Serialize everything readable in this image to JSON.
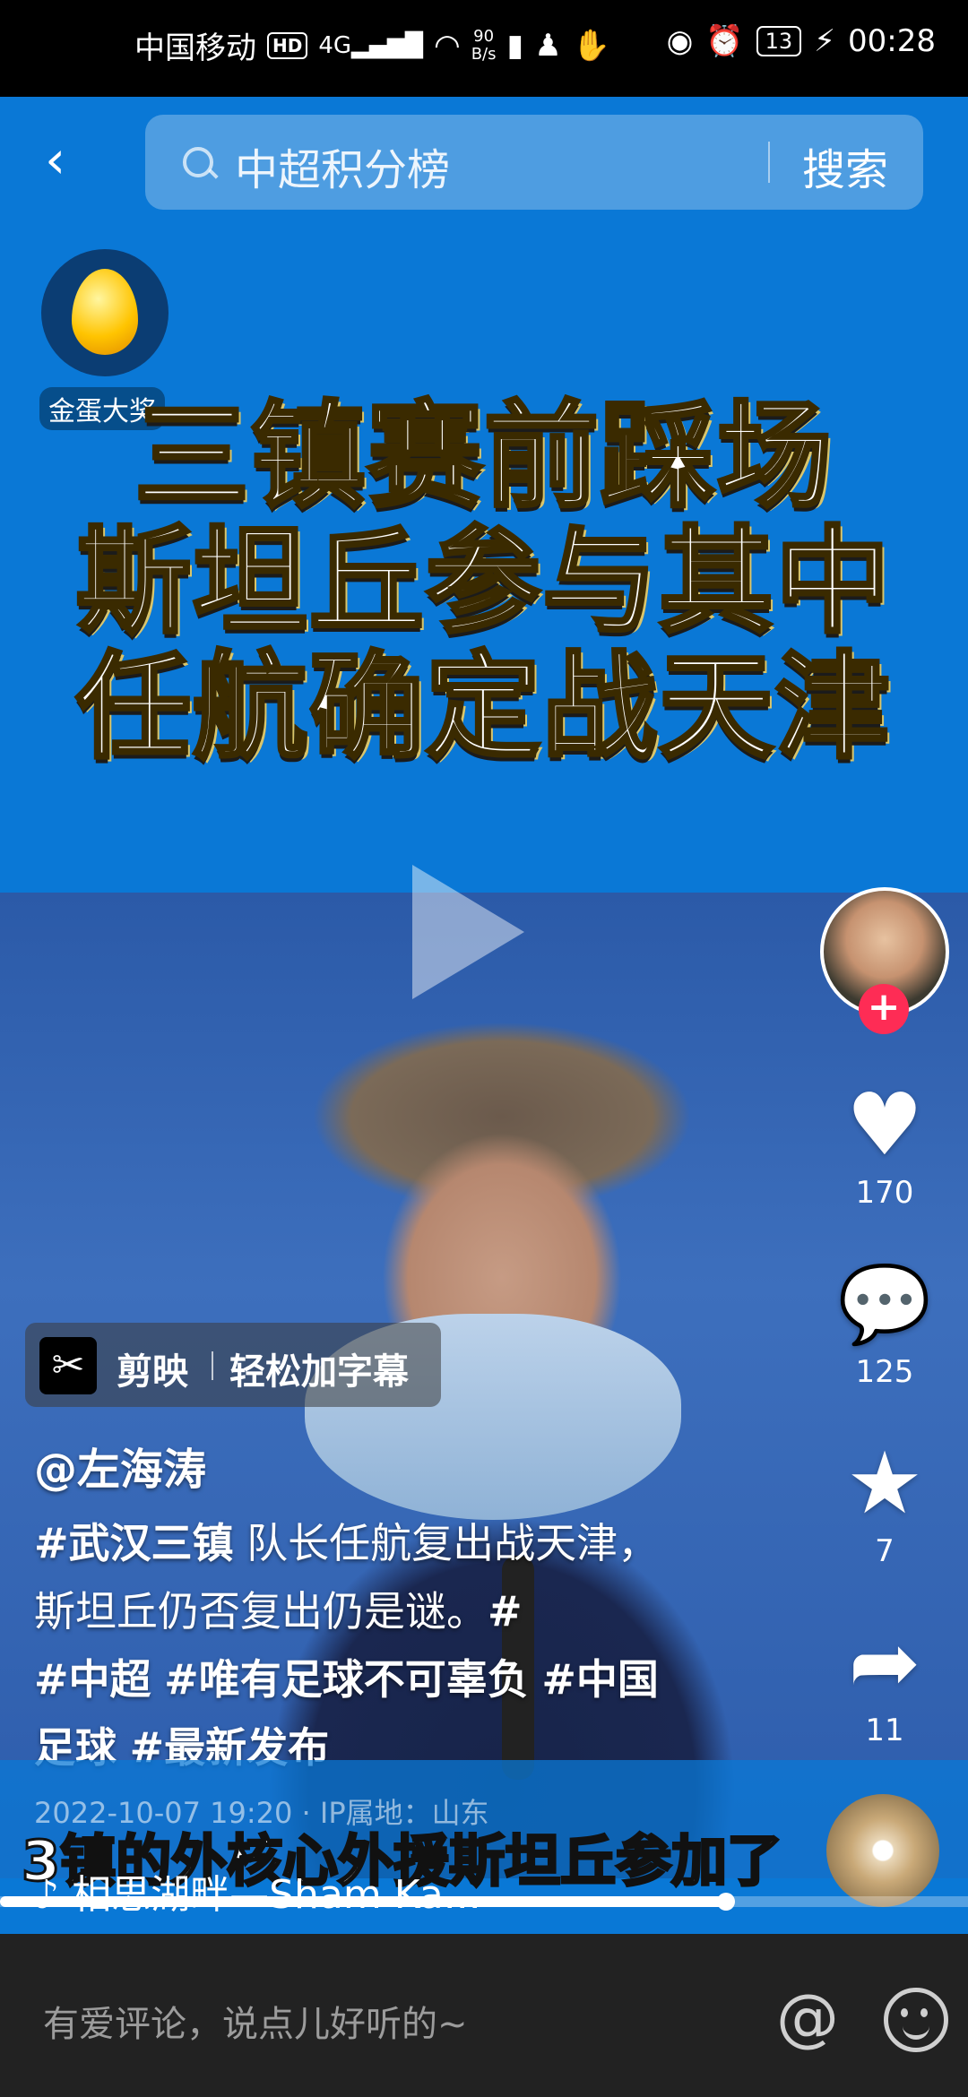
{
  "status_bar": {
    "carrier": "中国移动",
    "hd": "HD",
    "signal": "4G",
    "net_speed_value": "90",
    "net_speed_unit": "B/s",
    "battery": "13",
    "time": "00:28"
  },
  "search": {
    "query": "中超积分榜",
    "button": "搜索"
  },
  "promo": {
    "label": "金蛋大奖"
  },
  "video_title": {
    "line1": "三镇赛前踩场",
    "line2": "斯坦丘参与其中",
    "line3": "任航确定战天津"
  },
  "actions": {
    "likes": "170",
    "comments": "125",
    "favorites": "7",
    "shares": "11"
  },
  "capcut": {
    "name": "剪映",
    "text": "轻松加字幕"
  },
  "post": {
    "author": "@左海涛",
    "desc_tag1": "#武汉三镇",
    "desc_text1": " 队长任航复出战天津，斯坦丘仍否复出仍是谜。",
    "desc_tag2": "#中超",
    "desc_tag3": "#唯有足球不可辜负",
    "desc_tag4": "#中国足球",
    "desc_tag5": "#最新发布",
    "meta": "2022-10-07 19:20 · IP属地：山东",
    "subtitle": "3镇的外核心外援斯坦丘参加了"
  },
  "music": {
    "title": "相思湖畔—Sham Ka..."
  },
  "progress": {
    "fraction": 0.75
  },
  "comment": {
    "placeholder": "有爱评论，说点儿好听的~",
    "at": "@"
  },
  "colors": {
    "video_bg": "#0a78d6",
    "follow": "#fe2c55"
  }
}
